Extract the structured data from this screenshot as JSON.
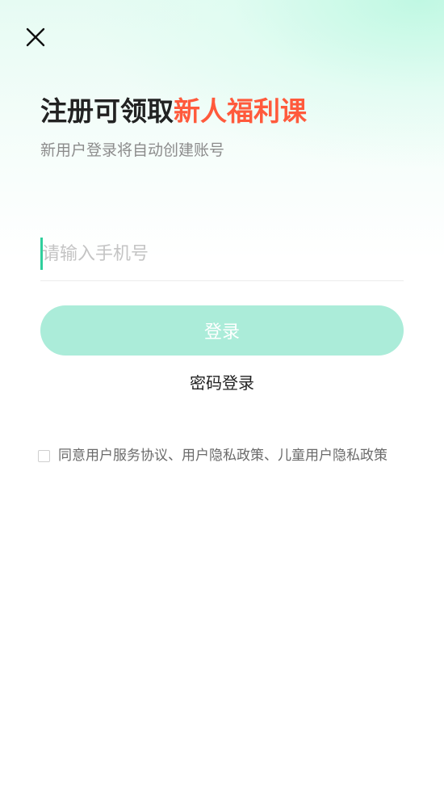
{
  "header": {
    "close_icon": "close-icon",
    "title_prefix": "注册可领取",
    "title_highlight": "新人福利课",
    "subtitle": "新用户登录将自动创建账号"
  },
  "form": {
    "phone_placeholder": "请输入手机号",
    "phone_value": "",
    "login_label": "登录",
    "password_login_label": "密码登录"
  },
  "agreement": {
    "checked": false,
    "prefix": "同意",
    "user_agreement": "用户服务协议",
    "separator_1": "、",
    "privacy_policy": "用户隐私政策",
    "separator_2": "、",
    "child_privacy_policy": "儿童用户隐私政策"
  },
  "colors": {
    "accent": "#2fcf9c",
    "highlight": "#ff5a3c",
    "button_disabled": "#abecd9"
  }
}
